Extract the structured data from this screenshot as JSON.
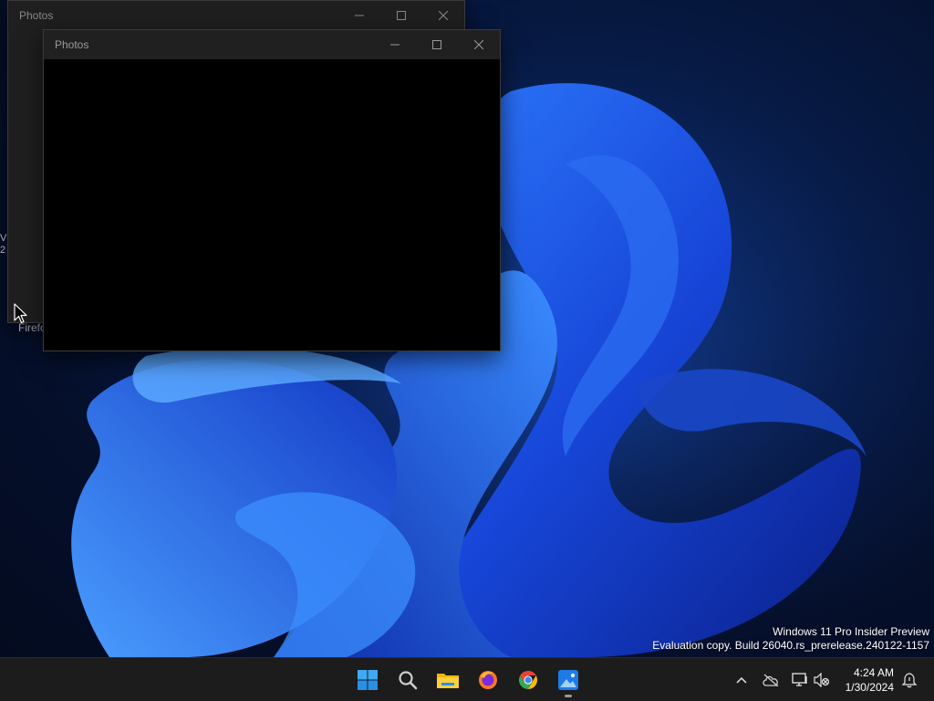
{
  "desktop": {
    "icon_label": "Firefo",
    "icon_stub_text": "V\n2"
  },
  "windows": {
    "back": {
      "title": "Photos"
    },
    "front": {
      "title": "Photos"
    }
  },
  "watermark": {
    "line1": "Windows 11 Pro Insider Preview",
    "line2": "Evaluation copy. Build 26040.rs_prerelease.240122-1157"
  },
  "taskbar": {
    "apps": [
      {
        "name": "start",
        "icon": "windows-logo-icon"
      },
      {
        "name": "search",
        "icon": "search-icon"
      },
      {
        "name": "file-explorer",
        "icon": "folder-icon"
      },
      {
        "name": "firefox",
        "icon": "firefox-icon"
      },
      {
        "name": "chrome",
        "icon": "chrome-icon"
      },
      {
        "name": "photos",
        "icon": "photos-icon",
        "active": true
      }
    ],
    "tray": {
      "icons": [
        "chevron-up-icon",
        "cloud-offline-icon",
        "network-icon",
        "volume-muted-icon",
        "notification-icon"
      ]
    },
    "clock": {
      "time": "4:24 AM",
      "date": "1/30/2024"
    }
  },
  "colors": {
    "taskbar_bg": "#1c1c1c",
    "window_bg": "#202020",
    "accent_blue": "#1e5cff"
  }
}
